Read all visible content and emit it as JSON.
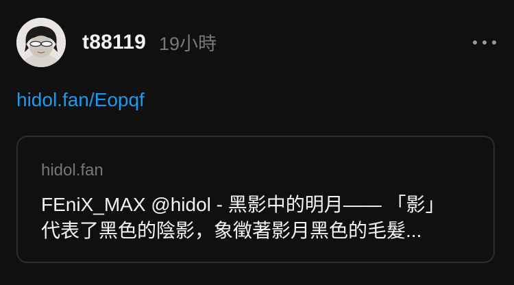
{
  "post": {
    "username": "t88119",
    "timestamp": "19小時",
    "more_icon": "more-horizontal-icon",
    "link_text": "hidol.fan/Eopqf"
  },
  "link_card": {
    "domain": "hidol.fan",
    "title_line1": "FEniX_MAX @hidol - 黑影中的明月—— 「影」",
    "title_line2": "代表了黑色的陰影，象徵著影月黑色的毛髮..."
  },
  "colors": {
    "background": "#101010",
    "primary_text": "#f3f5f7",
    "secondary_text": "#777777",
    "link": "#1d9bf0",
    "card_border": "#2e2e2e"
  }
}
